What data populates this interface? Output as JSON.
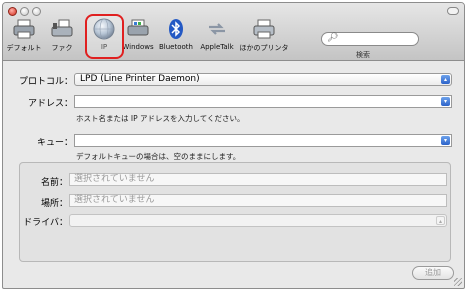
{
  "toolbar": {
    "items": [
      {
        "label": "デフォルト",
        "icon": "printer-icon"
      },
      {
        "label": "ファク",
        "icon": "fax-icon"
      },
      {
        "label": "IP",
        "icon": "globe-icon"
      },
      {
        "label": "Windows",
        "icon": "windows-printer-icon"
      },
      {
        "label": "Bluetooth",
        "icon": "bluetooth-icon"
      },
      {
        "label": "AppleTalk",
        "icon": "appletalk-icon"
      },
      {
        "label": "ほかのプリンタ",
        "icon": "other-printer-icon"
      }
    ],
    "search_placeholder": "",
    "search_label": "検索"
  },
  "form": {
    "protocol_label": "プロトコル：",
    "protocol_value": "LPD (Line Printer Daemon)",
    "address_label": "アドレス：",
    "address_value": "",
    "address_hint": "ホスト名または IP アドレスを入力してください。",
    "queue_label": "キュー：",
    "queue_value": "",
    "queue_hint": "デフォルトキューの場合は、空のままにします。"
  },
  "details": {
    "name_label": "名前：",
    "name_value": "選択されていません",
    "location_label": "場所：",
    "location_value": "選択されていません",
    "driver_label": "ドライバ：",
    "driver_value": ""
  },
  "actions": {
    "add_label": "追加"
  },
  "colors": {
    "highlight": "#e02020",
    "accent": "#2b62c9"
  }
}
